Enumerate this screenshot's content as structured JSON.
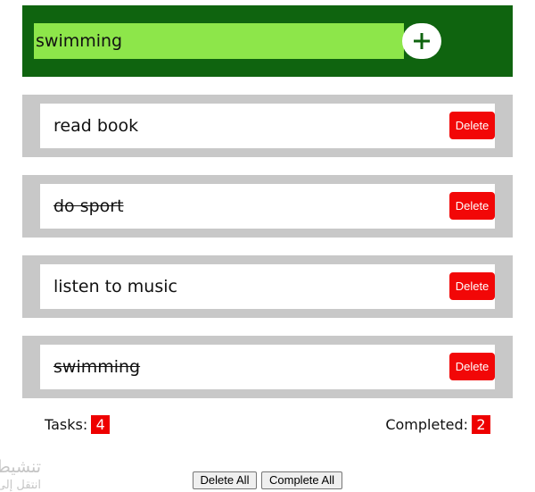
{
  "add_task": {
    "input_value": "swimming",
    "button_icon": "plus-icon"
  },
  "tasks": [
    {
      "label": "read book",
      "completed": false,
      "delete_label": "Delete"
    },
    {
      "label": "do sport",
      "completed": true,
      "delete_label": "Delete"
    },
    {
      "label": "listen to music",
      "completed": false,
      "delete_label": "Delete"
    },
    {
      "label": "swimming",
      "completed": true,
      "delete_label": "Delete"
    }
  ],
  "stats": {
    "tasks_label": "Tasks:",
    "tasks_count": "4",
    "completed_label": "Completed:",
    "completed_count": "2"
  },
  "watermark": {
    "line1": "تنشيط",
    "line2": "انتقل إلى"
  },
  "footer": {
    "delete_all_label": "Delete All",
    "complete_all_label": "Complete All"
  },
  "colors": {
    "header_bg": "#0f640f",
    "input_bg": "#8de64a",
    "task_frame": "#c8c8c8",
    "delete_button": "#f20707",
    "badge": "#ee0000"
  }
}
